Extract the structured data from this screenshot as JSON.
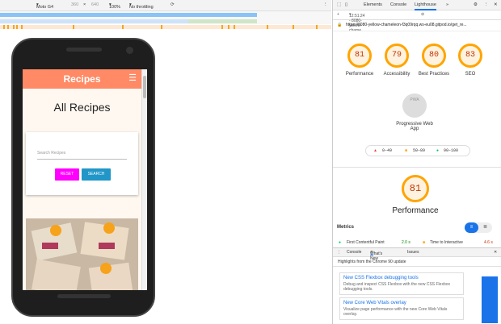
{
  "device_toolbar": {
    "device": "Moto G4",
    "width": "360",
    "x": "×",
    "height": "640",
    "zoom": "100%",
    "throttle": "No throttling"
  },
  "app": {
    "title": "Recipes",
    "menu": "☰",
    "heading": "All Recipes",
    "search_placeholder": "Search Recipes",
    "reset_label": "RESET",
    "search_label": "SEARCH"
  },
  "devtools": {
    "tabs": [
      "Elements",
      "Console",
      "Lighthouse",
      "»"
    ],
    "lh_report": "12:51:24 - 8080-yellow-chame",
    "url": "https://8080-yellow-chameleon-f3q09rqq.ws-eu08.gitpod.io/get_re...",
    "scores": [
      {
        "value": "81",
        "label": "Performance"
      },
      {
        "value": "79",
        "label": "Accessibility"
      },
      {
        "value": "80",
        "label": "Best Practices"
      },
      {
        "value": "83",
        "label": "SEO"
      }
    ],
    "pwa_badge": "PWA",
    "pwa_label": "Progressive Web App",
    "legend": [
      "0–49",
      "50–89",
      "90–100"
    ],
    "big_score": "81",
    "big_label": "Performance",
    "metrics_label": "Metrics",
    "metric1": "First Contentful Paint",
    "metric1_val": "2.0 s",
    "metric2": "Time to Interactive",
    "metric2_val": "4.6 s",
    "drawer_tabs": [
      "Console",
      "What's New",
      "Issues"
    ],
    "highlights": "Highlights from the Chrome 90 update",
    "news": [
      {
        "title": "New CSS Flexbox debugging tools",
        "desc": "Debug and inspect CSS Flexbox with the new CSS Flexbox debugging tools."
      },
      {
        "title": "New Core Web Vitals overlay",
        "desc": "Visualize page performance with the new Core Web Vitals overlay."
      }
    ]
  },
  "colors": {
    "accent": "#ff8a65",
    "gauge": "#ffa400",
    "reset": "#ff00ff",
    "search": "#2196c8"
  }
}
